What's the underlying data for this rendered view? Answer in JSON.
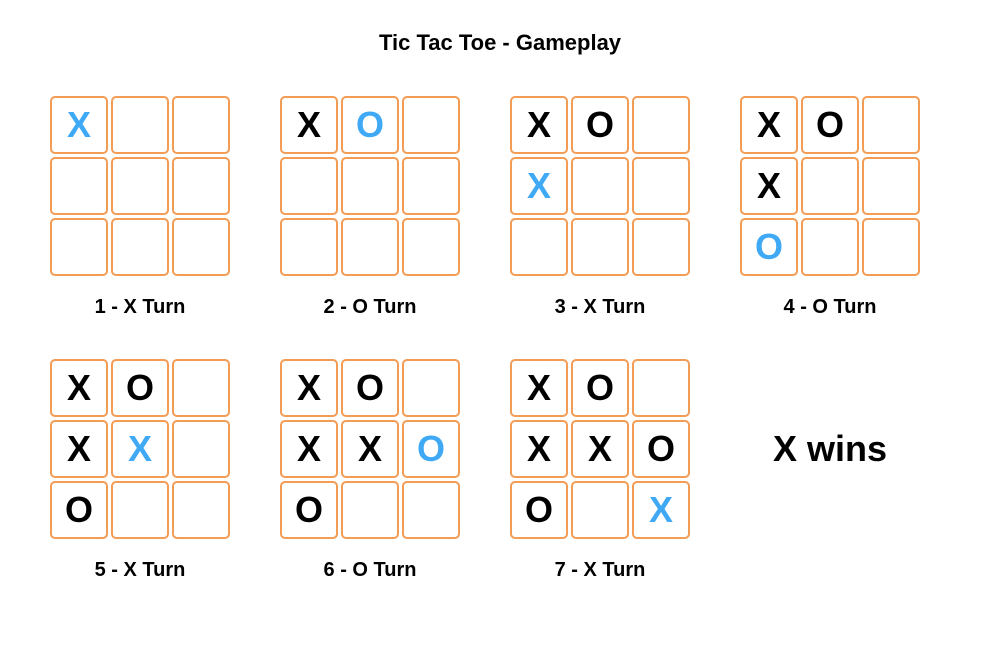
{
  "title": "Tic Tac Toe - Gameplay",
  "result": "X wins",
  "boards": [
    {
      "caption": "1 - X Turn",
      "highlightIndex": 0,
      "cells": [
        "X",
        "",
        "",
        "",
        "",
        "",
        "",
        "",
        ""
      ]
    },
    {
      "caption": "2 - O Turn",
      "highlightIndex": 1,
      "cells": [
        "X",
        "O",
        "",
        "",
        "",
        "",
        "",
        "",
        ""
      ]
    },
    {
      "caption": "3 - X Turn",
      "highlightIndex": 3,
      "cells": [
        "X",
        "O",
        "",
        "X",
        "",
        "",
        "",
        "",
        ""
      ]
    },
    {
      "caption": "4 - O Turn",
      "highlightIndex": 6,
      "cells": [
        "X",
        "O",
        "",
        "X",
        "",
        "",
        "O",
        "",
        ""
      ]
    },
    {
      "caption": "5 - X Turn",
      "highlightIndex": 4,
      "cells": [
        "X",
        "O",
        "",
        "X",
        "X",
        "",
        "O",
        "",
        ""
      ]
    },
    {
      "caption": "6 - O Turn",
      "highlightIndex": 5,
      "cells": [
        "X",
        "O",
        "",
        "X",
        "X",
        "O",
        "O",
        "",
        ""
      ]
    },
    {
      "caption": "7 - X Turn",
      "highlightIndex": 8,
      "cells": [
        "X",
        "O",
        "",
        "X",
        "X",
        "O",
        "O",
        "",
        "X"
      ]
    }
  ]
}
